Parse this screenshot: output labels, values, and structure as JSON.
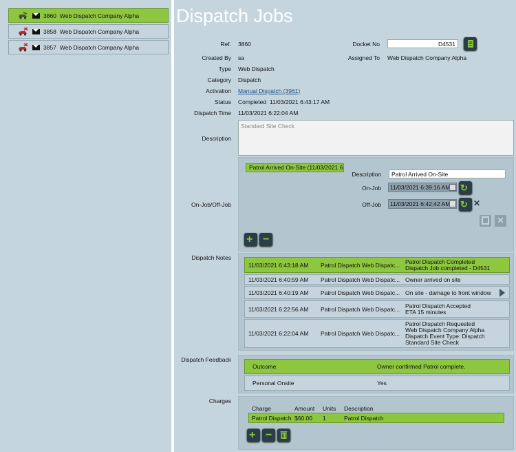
{
  "jobs": [
    {
      "num": "3860",
      "name": "Web Dispatch Company Alpha",
      "selected": true
    },
    {
      "num": "3858",
      "name": "Web Dispatch Company Alpha",
      "selected": false
    },
    {
      "num": "3857",
      "name": "Web Dispatch Company Alpha",
      "selected": false
    }
  ],
  "title": "Dispatch Jobs",
  "details": {
    "ref_label": "Ref.",
    "ref": "3860",
    "docket_label": "Docket No",
    "docket": "D4531",
    "created_label": "Created By",
    "created": "sa",
    "assigned_label": "Assigned To",
    "assigned": "Web Dispatch Company Alpha",
    "type_label": "Type",
    "type": "Web Dispatch",
    "category_label": "Category",
    "category": "Dispatch",
    "activation_label": "Activation",
    "activation": "Manual Dispatch (3961)",
    "status_label": "Status",
    "status": "Completed  11/03/2021 6:43:17 AM",
    "dtime_label": "Dispatch Time",
    "dtime": "11/03/2021 6:22:04 AM",
    "desc_label": "Description",
    "desc_placeholder": "Standard Site Check"
  },
  "onjob": {
    "label": "On-Job/Off-Job",
    "item": "Patrol Arrived On-Site (11/03/2021 6",
    "desc_label": "Description",
    "desc": "Patrol Arrived On-Site",
    "on_label": "On-Job",
    "on": "11/03/2021 6:39:16 AM",
    "off_label": "Off-Job",
    "off": "11/03/2021 6:42:42 AM"
  },
  "notes": {
    "label": "Dispatch Notes",
    "rows": [
      {
        "time": "11/03/2021 6:43:18 AM",
        "who": "Patrol Dispatch Web Dispatc...",
        "text": [
          "Patrol Dispatch Completed",
          "Dispatch Job completed - D4531"
        ]
      },
      {
        "time": "11/03/2021 6:40:59 AM",
        "who": "Patrol Dispatch Web Dispatc...",
        "text": [
          "Owner arrived on site"
        ]
      },
      {
        "time": "11/03/2021 6:40:19 AM",
        "who": "Patrol Dispatch Web Dispatc...",
        "text": [
          "On site - damage to front window"
        ]
      },
      {
        "time": "11/03/2021 6:22:56 AM",
        "who": "Patrol Dispatch Web Dispatc...",
        "text": [
          "Patrol Dispatch Accepted",
          "ETA 15 minutes"
        ]
      },
      {
        "time": "11/03/2021 6:22:04 AM",
        "who": "Patrol Dispatch Web Dispatc...",
        "text": [
          "Patrol Dispatch Requested",
          "Web Dispatch Company Alpha",
          "Dispatch Event Type: Dispatch",
          "Standard Site Check"
        ]
      }
    ]
  },
  "feedback": {
    "label": "Dispatch Feedback",
    "rows": [
      {
        "k": "Outcome",
        "v": "Owner confirmed Patrol complete."
      },
      {
        "k": "Personal Onsite",
        "v": "Yes"
      }
    ]
  },
  "charges": {
    "label": "Charges",
    "headers": [
      "Charge",
      "Amount",
      "Units",
      "Description"
    ],
    "row": [
      "Patrol Dispatch",
      "$60.00",
      "1",
      "Patrol Dispatch"
    ]
  },
  "colors": {
    "accent": "#8dc63f",
    "panel": "#b3c5ce",
    "bg": "#c5d5de"
  }
}
